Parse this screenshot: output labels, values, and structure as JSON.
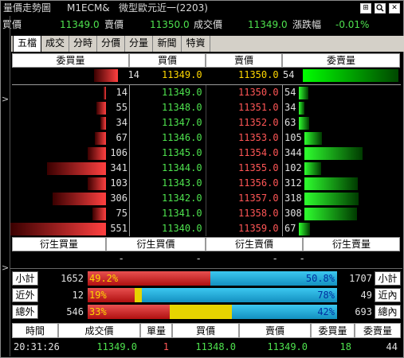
{
  "title": {
    "app": "量價走勢圖",
    "symbol": "M1ECM&",
    "name": "微型歐元近一(2203)"
  },
  "quote": {
    "bid_label": "買價",
    "bid": "11349.0",
    "ask_label": "賣價",
    "ask": "11350.0",
    "trade_label": "成交價",
    "trade": "11349.0",
    "change_label": "漲跌幅",
    "change": "-0.01%"
  },
  "tabs": [
    "五檔",
    "成交",
    "分時",
    "分價",
    "分量",
    "新聞",
    "特資"
  ],
  "book_headers": {
    "bid_qty": "委買量",
    "bid": "買價",
    "ask": "賣價",
    "ask_qty": "委賣量"
  },
  "best": {
    "bid_qty": "14",
    "bid": "11349.0",
    "ask": "11350.0",
    "ask_qty": "54"
  },
  "rows": [
    {
      "bq": "14",
      "bp": "11349.0",
      "ap": "11350.0",
      "aq": "54",
      "bf": 0.025,
      "af": 0.1
    },
    {
      "bq": "55",
      "bp": "11348.0",
      "ap": "11351.0",
      "aq": "34",
      "bf": 0.1,
      "af": 0.06
    },
    {
      "bq": "34",
      "bp": "11347.0",
      "ap": "11352.0",
      "aq": "63",
      "bf": 0.06,
      "af": 0.11
    },
    {
      "bq": "67",
      "bp": "11346.0",
      "ap": "11353.0",
      "aq": "105",
      "bf": 0.12,
      "af": 0.19
    },
    {
      "bq": "106",
      "bp": "11345.0",
      "ap": "11354.0",
      "aq": "344",
      "bf": 0.19,
      "af": 0.62
    },
    {
      "bq": "341",
      "bp": "11344.0",
      "ap": "11355.0",
      "aq": "102",
      "bf": 0.62,
      "af": 0.18
    },
    {
      "bq": "103",
      "bp": "11343.0",
      "ap": "11356.0",
      "aq": "312",
      "bf": 0.19,
      "af": 0.57
    },
    {
      "bq": "306",
      "bp": "11342.0",
      "ap": "11357.0",
      "aq": "318",
      "bf": 0.56,
      "af": 0.58
    },
    {
      "bq": "75",
      "bp": "11341.0",
      "ap": "11358.0",
      "aq": "308",
      "bf": 0.14,
      "af": 0.56
    },
    {
      "bq": "551",
      "bp": "11340.0",
      "ap": "11359.0",
      "aq": "67",
      "bf": 1.0,
      "af": 0.12
    }
  ],
  "derived": {
    "headers": [
      "衍生買量",
      "衍生買價",
      "衍生賣價",
      "衍生賣量"
    ],
    "values": [
      "-",
      "-",
      "-",
      "-"
    ]
  },
  "stats": [
    {
      "left_label": "小計",
      "left": "1652",
      "pct_a": "49.2%",
      "pct_b": "50.8%",
      "a": 0.492,
      "mid": 0.0,
      "right": "1707",
      "right_label": "小計"
    },
    {
      "left_label": "近外",
      "left": "12",
      "pct_a": "19%",
      "pct_b": "78%",
      "a": 0.19,
      "mid": 0.03,
      "right": "49",
      "right_label": "近內"
    },
    {
      "left_label": "總外",
      "left": "546",
      "pct_a": "33%",
      "pct_b": "42%",
      "a": 0.33,
      "mid": 0.25,
      "right": "693",
      "right_label": "總內"
    }
  ],
  "trade_headers": [
    "時間",
    "成交價",
    "單量",
    "買價",
    "賣價",
    "委買量",
    "委賣量"
  ],
  "trade_row": [
    "20:31:26",
    "11349.0",
    "1",
    "11348.0",
    "11349.0",
    "18",
    "44"
  ],
  "controls": {
    "pin": "⊞",
    "search": "🔍",
    "close": "✕"
  }
}
